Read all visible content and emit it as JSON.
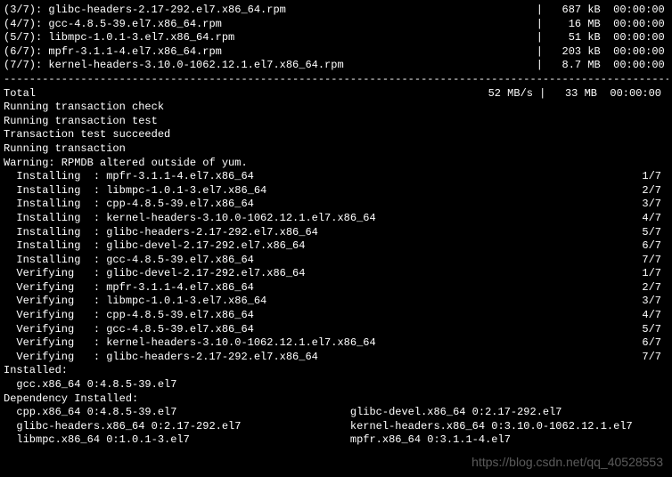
{
  "downloads": [
    {
      "idx": "(3/7):",
      "pkg": "glibc-headers-2.17-292.el7.x86_64.rpm",
      "size": "687 kB",
      "time": "00:00:00"
    },
    {
      "idx": "(4/7):",
      "pkg": "gcc-4.8.5-39.el7.x86_64.rpm",
      "size": "16 MB",
      "time": "00:00:00"
    },
    {
      "idx": "(5/7):",
      "pkg": "libmpc-1.0.1-3.el7.x86_64.rpm",
      "size": "51 kB",
      "time": "00:00:00"
    },
    {
      "idx": "(6/7):",
      "pkg": "mpfr-3.1.1-4.el7.x86_64.rpm",
      "size": "203 kB",
      "time": "00:00:00"
    },
    {
      "idx": "(7/7):",
      "pkg": "kernel-headers-3.10.0-1062.12.1.el7.x86_64.rpm",
      "size": "8.7 MB",
      "time": "00:00:00"
    }
  ],
  "sep": "--------------------------------------------------------------------------------------------------------",
  "total": {
    "label": "Total",
    "speed": "52 MB/s",
    "size": "33 MB",
    "time": "00:00:00"
  },
  "txn": {
    "check": "Running transaction check",
    "test": "Running transaction test",
    "succeeded": "Transaction test succeeded",
    "running": "Running transaction",
    "warning": "Warning: RPMDB altered outside of yum."
  },
  "steps": [
    {
      "action": "Installing",
      "pkg": "mpfr-3.1.1-4.el7.x86_64",
      "prog": "1/7"
    },
    {
      "action": "Installing",
      "pkg": "libmpc-1.0.1-3.el7.x86_64",
      "prog": "2/7"
    },
    {
      "action": "Installing",
      "pkg": "cpp-4.8.5-39.el7.x86_64",
      "prog": "3/7"
    },
    {
      "action": "Installing",
      "pkg": "kernel-headers-3.10.0-1062.12.1.el7.x86_64",
      "prog": "4/7"
    },
    {
      "action": "Installing",
      "pkg": "glibc-headers-2.17-292.el7.x86_64",
      "prog": "5/7"
    },
    {
      "action": "Installing",
      "pkg": "glibc-devel-2.17-292.el7.x86_64",
      "prog": "6/7"
    },
    {
      "action": "Installing",
      "pkg": "gcc-4.8.5-39.el7.x86_64",
      "prog": "7/7"
    },
    {
      "action": "Verifying",
      "pkg": "glibc-devel-2.17-292.el7.x86_64",
      "prog": "1/7"
    },
    {
      "action": "Verifying",
      "pkg": "mpfr-3.1.1-4.el7.x86_64",
      "prog": "2/7"
    },
    {
      "action": "Verifying",
      "pkg": "libmpc-1.0.1-3.el7.x86_64",
      "prog": "3/7"
    },
    {
      "action": "Verifying",
      "pkg": "cpp-4.8.5-39.el7.x86_64",
      "prog": "4/7"
    },
    {
      "action": "Verifying",
      "pkg": "gcc-4.8.5-39.el7.x86_64",
      "prog": "5/7"
    },
    {
      "action": "Verifying",
      "pkg": "kernel-headers-3.10.0-1062.12.1.el7.x86_64",
      "prog": "6/7"
    },
    {
      "action": "Verifying",
      "pkg": "glibc-headers-2.17-292.el7.x86_64",
      "prog": "7/7"
    }
  ],
  "installed": {
    "label": "Installed:",
    "items": [
      "gcc.x86_64 0:4.8.5-39.el7"
    ]
  },
  "dep_installed": {
    "label": "Dependency Installed:",
    "col1": [
      "cpp.x86_64 0:4.8.5-39.el7",
      "glibc-headers.x86_64 0:2.17-292.el7",
      "libmpc.x86_64 0:1.0.1-3.el7"
    ],
    "col2": [
      "glibc-devel.x86_64 0:2.17-292.el7",
      "kernel-headers.x86_64 0:3.10.0-1062.12.1.el7",
      "mpfr.x86_64 0:3.1.1-4.el7"
    ]
  },
  "watermark": "https://blog.csdn.net/qq_40528553"
}
